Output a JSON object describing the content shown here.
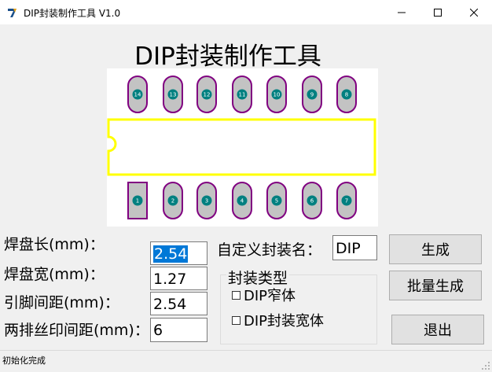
{
  "window": {
    "title": "DIP封装制作工具 V1.0",
    "controls": [
      "minimize",
      "maximize",
      "close"
    ]
  },
  "heading": "DIP封装制作工具",
  "preview": {
    "outline_color": "#ffff00",
    "pad_fill": "#c3c3c3",
    "pad_outline": "#800080",
    "hole_color": "#008080",
    "top_pins": [
      "14",
      "13",
      "12",
      "11",
      "10",
      "9",
      "8"
    ],
    "bottom_pins": [
      "1",
      "2",
      "3",
      "4",
      "5",
      "6",
      "7"
    ]
  },
  "form": {
    "pad_length": {
      "label": "焊盘长(mm)：",
      "value": "2.54"
    },
    "pad_width": {
      "label": "焊盘宽(mm)：",
      "value": "1.27"
    },
    "pin_pitch": {
      "label": "引脚间距(mm)：",
      "value": "2.54"
    },
    "row_spacing": {
      "label": "两排丝印间距(mm)：",
      "value": "6"
    },
    "package_name": {
      "label": "自定义封装名：",
      "value": "DIP"
    }
  },
  "package_type": {
    "title": "封装类型",
    "options": [
      {
        "label": "DIP窄体",
        "checked": false
      },
      {
        "label": "DIP封装宽体",
        "checked": false
      }
    ]
  },
  "buttons": {
    "generate": "生成",
    "batch_generate": "批量生成",
    "exit": "退出"
  },
  "status": "初始化完成"
}
